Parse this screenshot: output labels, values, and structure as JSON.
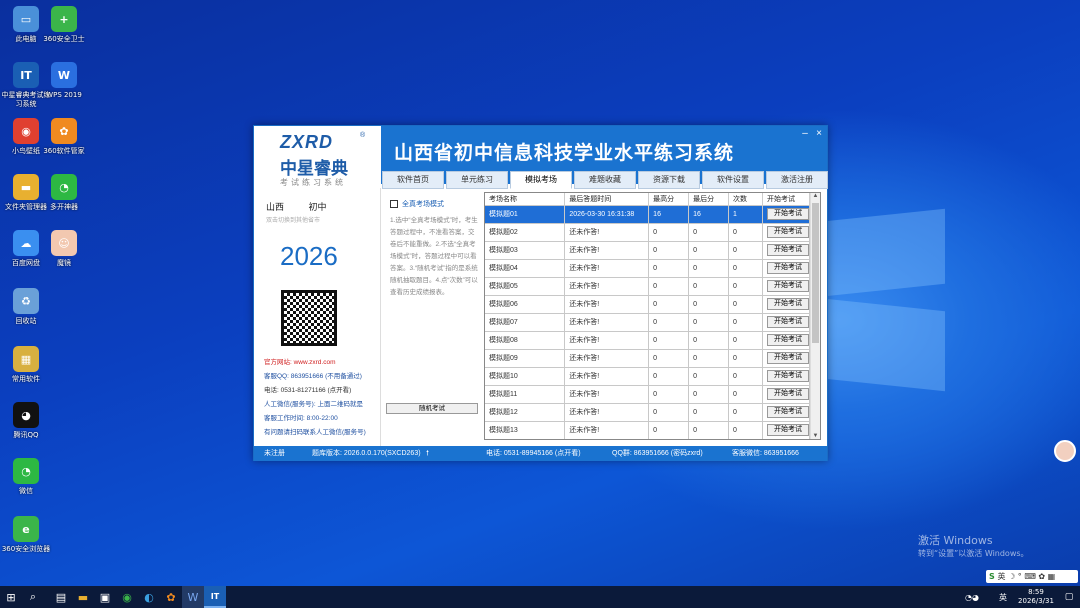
{
  "desktop": {
    "icons": [
      {
        "label": "此电脑",
        "icon": "computer-icon",
        "color": "#4a90d9",
        "glyph": "▭"
      },
      {
        "label": "360安全卫士",
        "icon": "shield-icon",
        "color": "#3bb54a",
        "glyph": "+"
      },
      {
        "label": "中星睿典考试练习系统",
        "icon": "exam-app-icon",
        "color": "#1a5fb4",
        "glyph": "IT"
      },
      {
        "label": "WPS 2019",
        "icon": "wps-icon",
        "color": "#2a6fe0",
        "glyph": "W"
      },
      {
        "label": "小鸟壁纸",
        "icon": "bird-icon",
        "color": "#e04030",
        "glyph": "◉"
      },
      {
        "label": "360软件管家",
        "icon": "softmgr-icon",
        "color": "#f08a20",
        "glyph": "✿"
      },
      {
        "label": "文件夹管理器",
        "icon": "folder-icon",
        "color": "#e8b030",
        "glyph": "▬"
      },
      {
        "label": "多开神器",
        "icon": "wechat-icon",
        "color": "#2db843",
        "glyph": "◔"
      },
      {
        "label": "百度网盘",
        "icon": "cloud-icon",
        "color": "#3a8ff0",
        "glyph": "☁"
      },
      {
        "label": "魔镜",
        "icon": "avatar-icon",
        "color": "#f2c8b0",
        "glyph": "☺"
      },
      {
        "label": "回收站",
        "icon": "recycle-bin-icon",
        "color": "#6aa0d8",
        "glyph": "♻"
      },
      {
        "label": "常用软件",
        "icon": "software-icon",
        "color": "#d8b040",
        "glyph": "▦"
      },
      {
        "label": "腾讯QQ",
        "icon": "qq-icon",
        "color": "#111111",
        "glyph": "◕"
      },
      {
        "label": "微信",
        "icon": "wechat-main-icon",
        "color": "#2db843",
        "glyph": "◔"
      },
      {
        "label": "360安全浏览器",
        "icon": "browser-icon",
        "color": "#3bb54a",
        "glyph": "e"
      }
    ],
    "watermark": {
      "title": "激活 Windows",
      "sub": "转到“设置”以激活 Windows。"
    }
  },
  "window": {
    "logo": {
      "main": "ZXRD",
      "reg": "®",
      "cn": "中星睿典",
      "sub": "考试练习系统"
    },
    "title": "山西省初中信息科技学业水平练习系统",
    "controls": {
      "min": "–",
      "close": "×"
    },
    "tabs": [
      "软件首页",
      "单元练习",
      "模拟考场",
      "难题收藏",
      "资源下载",
      "软件设置",
      "激活注册"
    ],
    "active_tab": 2,
    "left": {
      "province": "山西",
      "level": "初中",
      "hint": "双击切换到其他省市",
      "year": "2026",
      "site_label": "官方网站: www.zxrd.com",
      "qq": "客服QQ: 863951666 (不用备通过)",
      "tel": "电话: 0531-81271166 (点开看)",
      "wechat": "人工微信(服务号): 上面二维码就是",
      "hours": "客服工作时间: 8:00-22:00",
      "problem": "有问题请扫码联系人工微信(服务号)"
    },
    "middle": {
      "checkbox_label": "全真考场模式",
      "desc": "1.选中“全真考场模式”时，考生答题过程中，不准看答案，交卷后不能重做。2.不选“全真考场模式”时，答题过程中可以看答案。3.“随机考试”指的是系统随机抽取题目。4.点“次数”可以查看历史成绩报表。",
      "random_btn": "随机考试"
    },
    "table": {
      "headers": [
        "考场名称",
        "最后答题时间",
        "最高分",
        "最后分",
        "次数",
        "开始考试"
      ],
      "rows": [
        [
          "模拟题01",
          "2026-03-30 16:31:38",
          "16",
          "16",
          "1"
        ],
        [
          "模拟题02",
          "还未作答!",
          "0",
          "0",
          "0"
        ],
        [
          "模拟题03",
          "还未作答!",
          "0",
          "0",
          "0"
        ],
        [
          "模拟题04",
          "还未作答!",
          "0",
          "0",
          "0"
        ],
        [
          "模拟题05",
          "还未作答!",
          "0",
          "0",
          "0"
        ],
        [
          "模拟题06",
          "还未作答!",
          "0",
          "0",
          "0"
        ],
        [
          "模拟题07",
          "还未作答!",
          "0",
          "0",
          "0"
        ],
        [
          "模拟题08",
          "还未作答!",
          "0",
          "0",
          "0"
        ],
        [
          "模拟题09",
          "还未作答!",
          "0",
          "0",
          "0"
        ],
        [
          "模拟题10",
          "还未作答!",
          "0",
          "0",
          "0"
        ],
        [
          "模拟题11",
          "还未作答!",
          "0",
          "0",
          "0"
        ],
        [
          "模拟题12",
          "还未作答!",
          "0",
          "0",
          "0"
        ],
        [
          "模拟题13",
          "还未作答!",
          "0",
          "0",
          "0"
        ]
      ],
      "start_label": "开始考试"
    },
    "status": {
      "reg": "未注册",
      "version": "题库版本: 2026.0.0.170(SXCD263)",
      "tel": "电话: 0531-89945166 (点开看)",
      "qq": "QQ群: 863951666 (密码zxrd)",
      "wechat": "客服微信: 863951666"
    }
  },
  "taskbar": {
    "time": "8:59",
    "date": "2026/3/31",
    "ime": "英"
  }
}
